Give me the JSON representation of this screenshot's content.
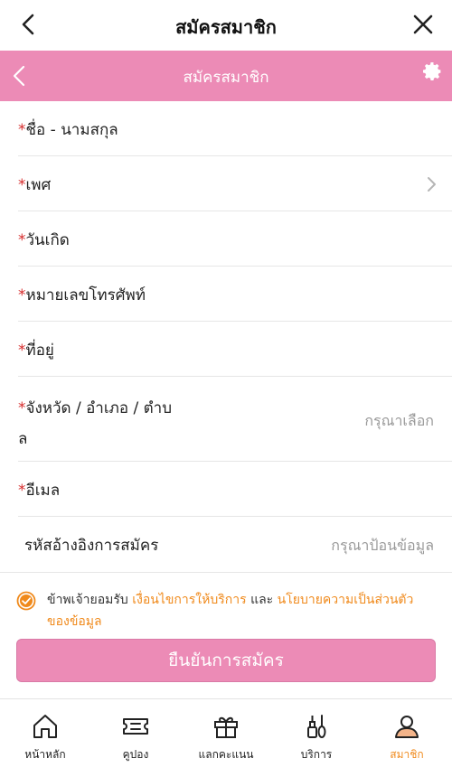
{
  "header": {
    "title": "สมัครสมาชิก"
  },
  "subheader": {
    "title": "สมัครสมาชิก"
  },
  "form": {
    "required_mark": "*",
    "name_label": "ชื่อ - นามสกุล",
    "gender_label": "เพศ",
    "birthday_label": "วันเกิด",
    "phone_label": "หมายเลขโทรศัพท์",
    "address_label": "ที่อยู่",
    "province_label_line1": "จังหวัด / อำเภอ / ตำบ",
    "province_label_line2": "ล",
    "province_value": "กรุณาเลือก",
    "email_label": "อีเมล",
    "referral_label": "รหัสอ้างอิงการสมัคร",
    "referral_placeholder": "กรุณาป้อนข้อมูล"
  },
  "agreement": {
    "prefix": "ข้าพเจ้ายอมรับ ",
    "terms_link": "เงื่อนไขการให้บริการ",
    "and": " และ ",
    "privacy_link": "นโยบายความเป็นส่วนตัวของข้อมูล",
    "checked": true
  },
  "submit_label": "ยืนยันการสมัคร",
  "tabs": [
    {
      "label": "หน้าหลัก",
      "icon": "home-icon"
    },
    {
      "label": "คูปอง",
      "icon": "coupon-icon"
    },
    {
      "label": "แลกคะแนน",
      "icon": "gift-icon"
    },
    {
      "label": "บริการ",
      "icon": "service-icon"
    },
    {
      "label": "สมาชิก",
      "icon": "member-icon",
      "active": true
    }
  ],
  "colors": {
    "brand_pink": "#ec8bb6",
    "accent_orange": "#f08a1c",
    "required_red": "#d62b2b"
  }
}
